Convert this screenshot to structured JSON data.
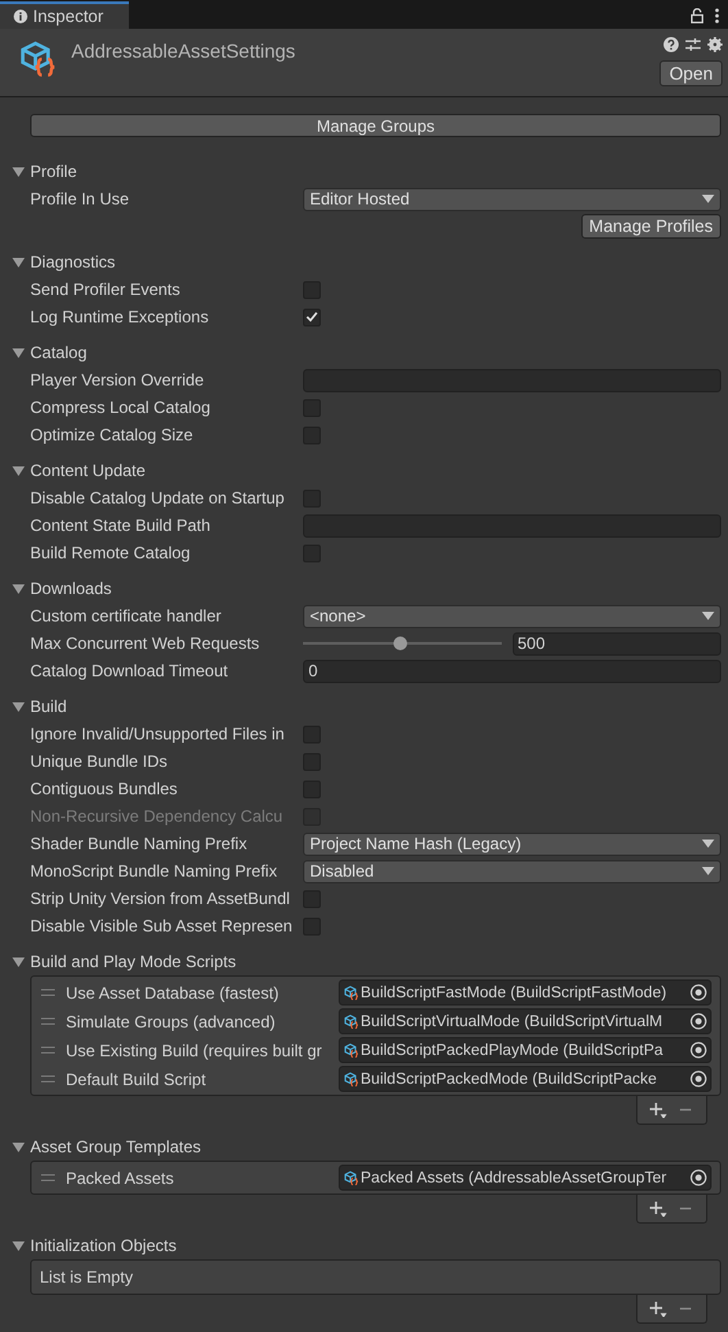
{
  "window": {
    "tab": "Inspector"
  },
  "header": {
    "title": "AddressableAssetSettings",
    "open_button": "Open"
  },
  "manage_groups": "Manage Groups",
  "sections": [
    {
      "kind": "fields",
      "title": "Profile",
      "expanded": true,
      "rows": [
        {
          "kind": "dropdown",
          "label": "Profile In Use",
          "value": "Editor Hosted"
        },
        {
          "kind": "button",
          "label": "Manage Profiles"
        }
      ]
    },
    {
      "kind": "fields",
      "title": "Diagnostics",
      "expanded": true,
      "rows": [
        {
          "kind": "checkbox",
          "label": "Send Profiler Events",
          "checked": false
        },
        {
          "kind": "checkbox",
          "label": "Log Runtime Exceptions",
          "checked": true
        }
      ]
    },
    {
      "kind": "fields",
      "title": "Catalog",
      "expanded": true,
      "rows": [
        {
          "kind": "text",
          "label": "Player Version Override"
        },
        {
          "kind": "checkbox",
          "label": "Compress Local Catalog",
          "checked": false
        },
        {
          "kind": "checkbox",
          "label": "Optimize Catalog Size",
          "checked": false
        }
      ]
    },
    {
      "kind": "fields",
      "title": "Content Update",
      "expanded": true,
      "rows": [
        {
          "kind": "checkbox",
          "label": "Disable Catalog Update on Startup",
          "checked": false
        },
        {
          "kind": "text",
          "label": "Content State Build Path"
        },
        {
          "kind": "checkbox",
          "label": "Build Remote Catalog",
          "checked": false
        }
      ]
    },
    {
      "kind": "fields",
      "title": "Downloads",
      "expanded": true,
      "rows": [
        {
          "kind": "dropdown",
          "label": "Custom certificate handler",
          "value": "<none>"
        },
        {
          "kind": "slider",
          "label": "Max Concurrent Web Requests",
          "level": 0.49,
          "reading": "500"
        },
        {
          "kind": "text",
          "label": "Catalog Download Timeout",
          "value": "0"
        }
      ]
    },
    {
      "kind": "fields",
      "title": "Build",
      "expanded": true,
      "rows": [
        {
          "kind": "checkbox",
          "label": "Ignore Invalid/Unsupported Files in",
          "checked": false,
          "disabled": false
        },
        {
          "kind": "checkbox",
          "label": "Unique Bundle IDs",
          "checked": false,
          "disabled": false
        },
        {
          "kind": "checkbox",
          "label": "Contiguous Bundles",
          "checked": false,
          "disabled": false
        },
        {
          "kind": "checkbox",
          "label": "Non-Recursive Dependency Calcu",
          "checked": false,
          "disabled": true
        },
        {
          "kind": "dropdown",
          "label": "Shader Bundle Naming Prefix",
          "value": "Project Name Hash (Legacy)",
          "disabled": false
        },
        {
          "kind": "dropdown",
          "label": "MonoScript Bundle Naming Prefix",
          "value": "Disabled",
          "disabled": false
        },
        {
          "kind": "checkbox",
          "label": "Strip Unity Version from AssetBundl",
          "checked": false,
          "disabled": false
        },
        {
          "kind": "checkbox",
          "label": "Disable Visible Sub Asset Represen",
          "checked": false,
          "disabled": false
        }
      ]
    },
    {
      "kind": "list",
      "title": "Build and Play Mode Scripts",
      "expanded": true,
      "items": [
        {
          "label": "Use Asset Database (fastest)",
          "value": "BuildScriptFastMode (BuildScriptFastMode)"
        },
        {
          "label": "Simulate Groups (advanced)",
          "value": "BuildScriptVirtualMode (BuildScriptVirtualM"
        },
        {
          "label": "Use Existing Build (requires built gr",
          "value": "BuildScriptPackedPlayMode (BuildScriptPa"
        },
        {
          "label": "Default Build Script",
          "value": "BuildScriptPackedMode (BuildScriptPacke"
        }
      ]
    },
    {
      "kind": "list",
      "title": "Asset Group Templates",
      "expanded": true,
      "items": [
        {
          "label": "Packed Assets",
          "value": "Packed Assets (AddressableAssetGroupTer"
        }
      ]
    },
    {
      "kind": "list",
      "title": "Initialization Objects",
      "expanded": true,
      "empty_text": "List is Empty"
    }
  ]
}
